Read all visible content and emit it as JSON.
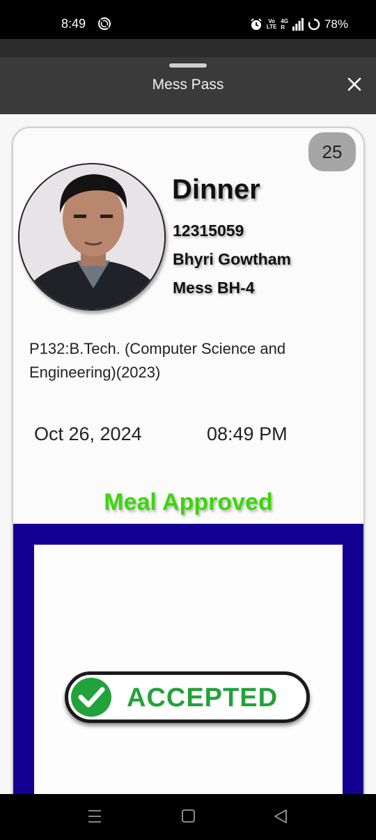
{
  "status_bar": {
    "time": "8:49",
    "battery": "78%",
    "volte_top": "Vo",
    "volte_bottom": "LTE",
    "network": "4G",
    "network_sub": "R"
  },
  "sheet": {
    "title": "Mess Pass"
  },
  "pass": {
    "count": "25",
    "meal_type": "Dinner",
    "registration_no": "12315059",
    "student_name": "Bhyri Gowtham",
    "mess": "Mess BH-4",
    "program": "P132:B.Tech. (Computer Science and Engineering)(2023)",
    "date": "Oct 26, 2024",
    "time": "08:49 PM",
    "status": "Meal Approved",
    "stamp": "ACCEPTED"
  },
  "colors": {
    "approved_green": "#3bd60a",
    "frame_blue": "#130093",
    "stamp_green": "#22a23b"
  },
  "icons": {
    "status": [
      "spiral-icon",
      "alarm-icon",
      "signal-icon",
      "battery-ring-icon"
    ],
    "header": [
      "close-icon"
    ],
    "navigation": [
      "menu-icon",
      "home-square-icon",
      "back-triangle-icon"
    ]
  }
}
